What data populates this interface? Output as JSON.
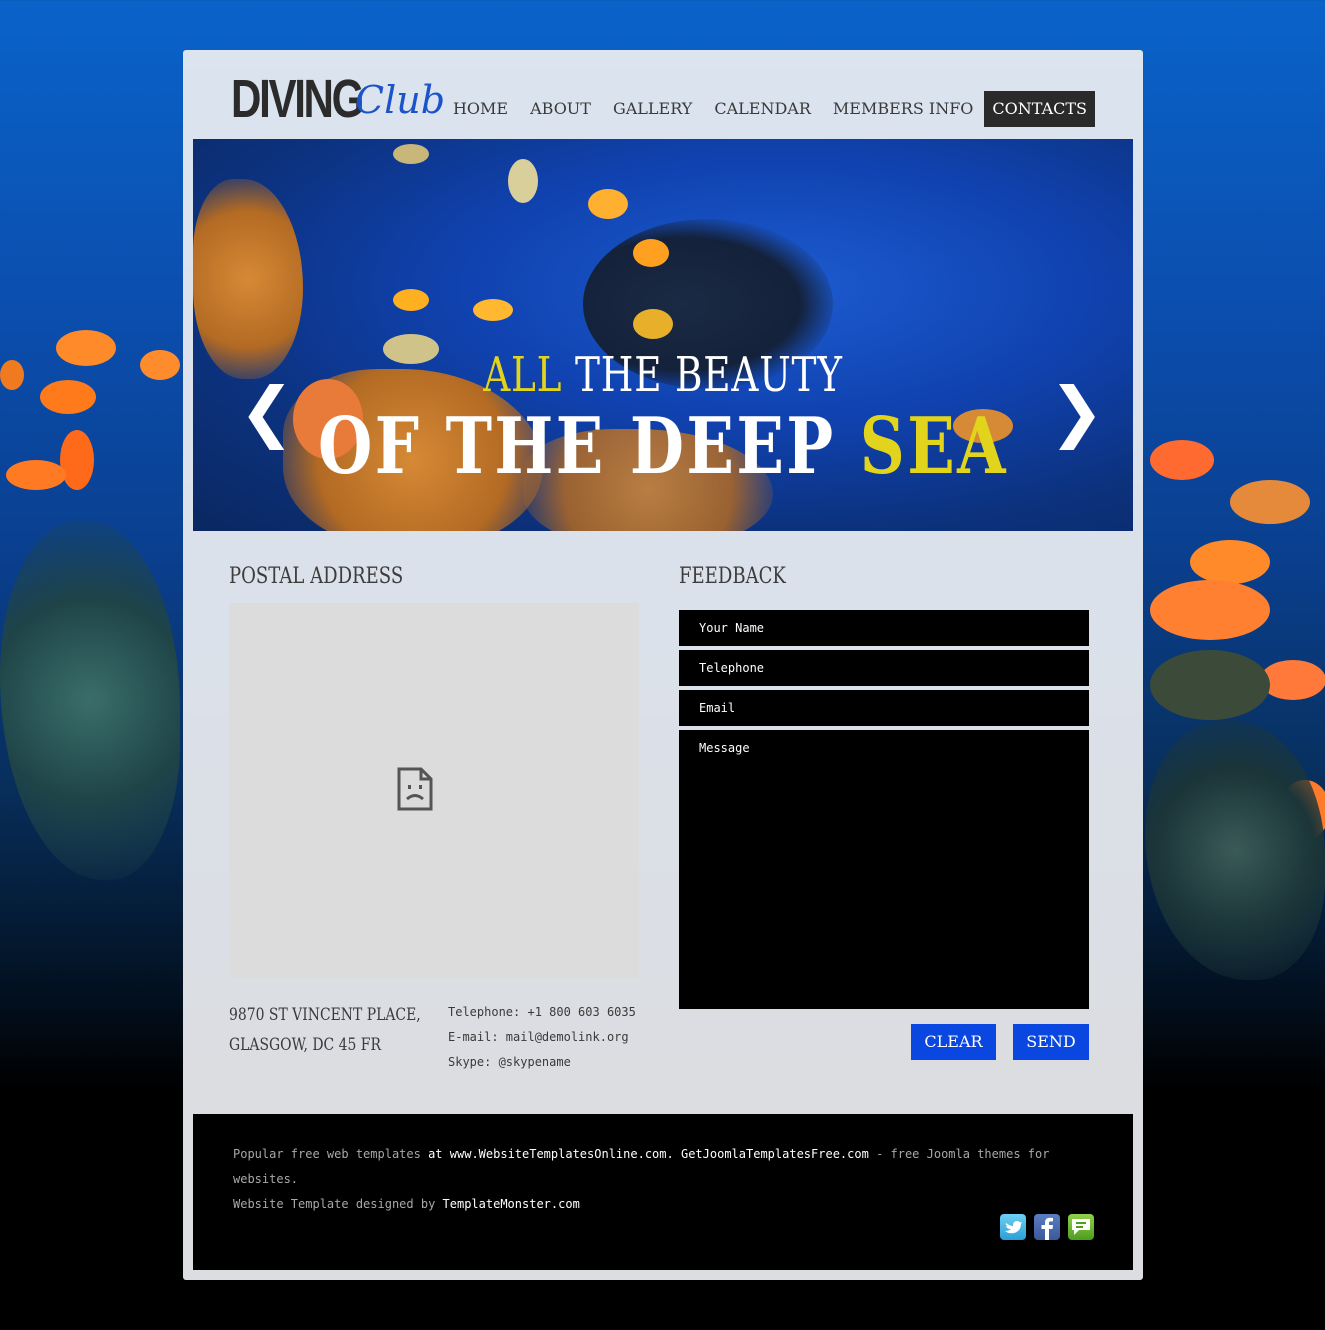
{
  "logo": {
    "main": "DIVING",
    "script": "Club"
  },
  "nav": {
    "items": [
      {
        "label": "HOME"
      },
      {
        "label": "ABOUT"
      },
      {
        "label": "GALLERY"
      },
      {
        "label": "CALENDAR"
      },
      {
        "label": "MEMBERS INFO"
      },
      {
        "label": "CONTACTS",
        "active": true
      }
    ]
  },
  "slider": {
    "line1_highlight": "ALL",
    "line1_rest": "THE BEAUTY",
    "line2_rest": "OF THE DEEP",
    "line2_highlight": "SEA",
    "prev_arrow": "❮",
    "next_arrow": "❯"
  },
  "postal": {
    "title": "POSTAL ADDRESS",
    "address_line1": "9870 ST VINCENT PLACE,",
    "address_line2": "GLASGOW, DC 45 FR",
    "telephone": "Telephone: +1 800 603 6035",
    "email": "E-mail: mail@demolink.org",
    "skype": "Skype: @skypename"
  },
  "feedback": {
    "title": "FEEDBACK",
    "name_placeholder": "Your Name",
    "telephone_placeholder": "Telephone",
    "email_placeholder": "Email",
    "message_placeholder": "Message",
    "clear_label": "CLEAR",
    "send_label": "SEND"
  },
  "footer": {
    "p1": "Popular free web templates",
    "p2": "at",
    "link1": "www.WebsiteTemplatesOnline.com",
    "p3": ".",
    "link2": "GetJoomlaTemplatesFree.com",
    "p4": "- free Joomla themes for websites.",
    "p5": "Website Template designed by",
    "link3": "TemplateMonster.com"
  },
  "colors": {
    "accent_blue": "#0a46e0",
    "highlight_yellow": "#e2d41c",
    "active_nav": "#2a2a2a"
  },
  "icons": [
    "broken-image-icon",
    "twitter-icon",
    "facebook-icon",
    "chat-icon"
  ]
}
